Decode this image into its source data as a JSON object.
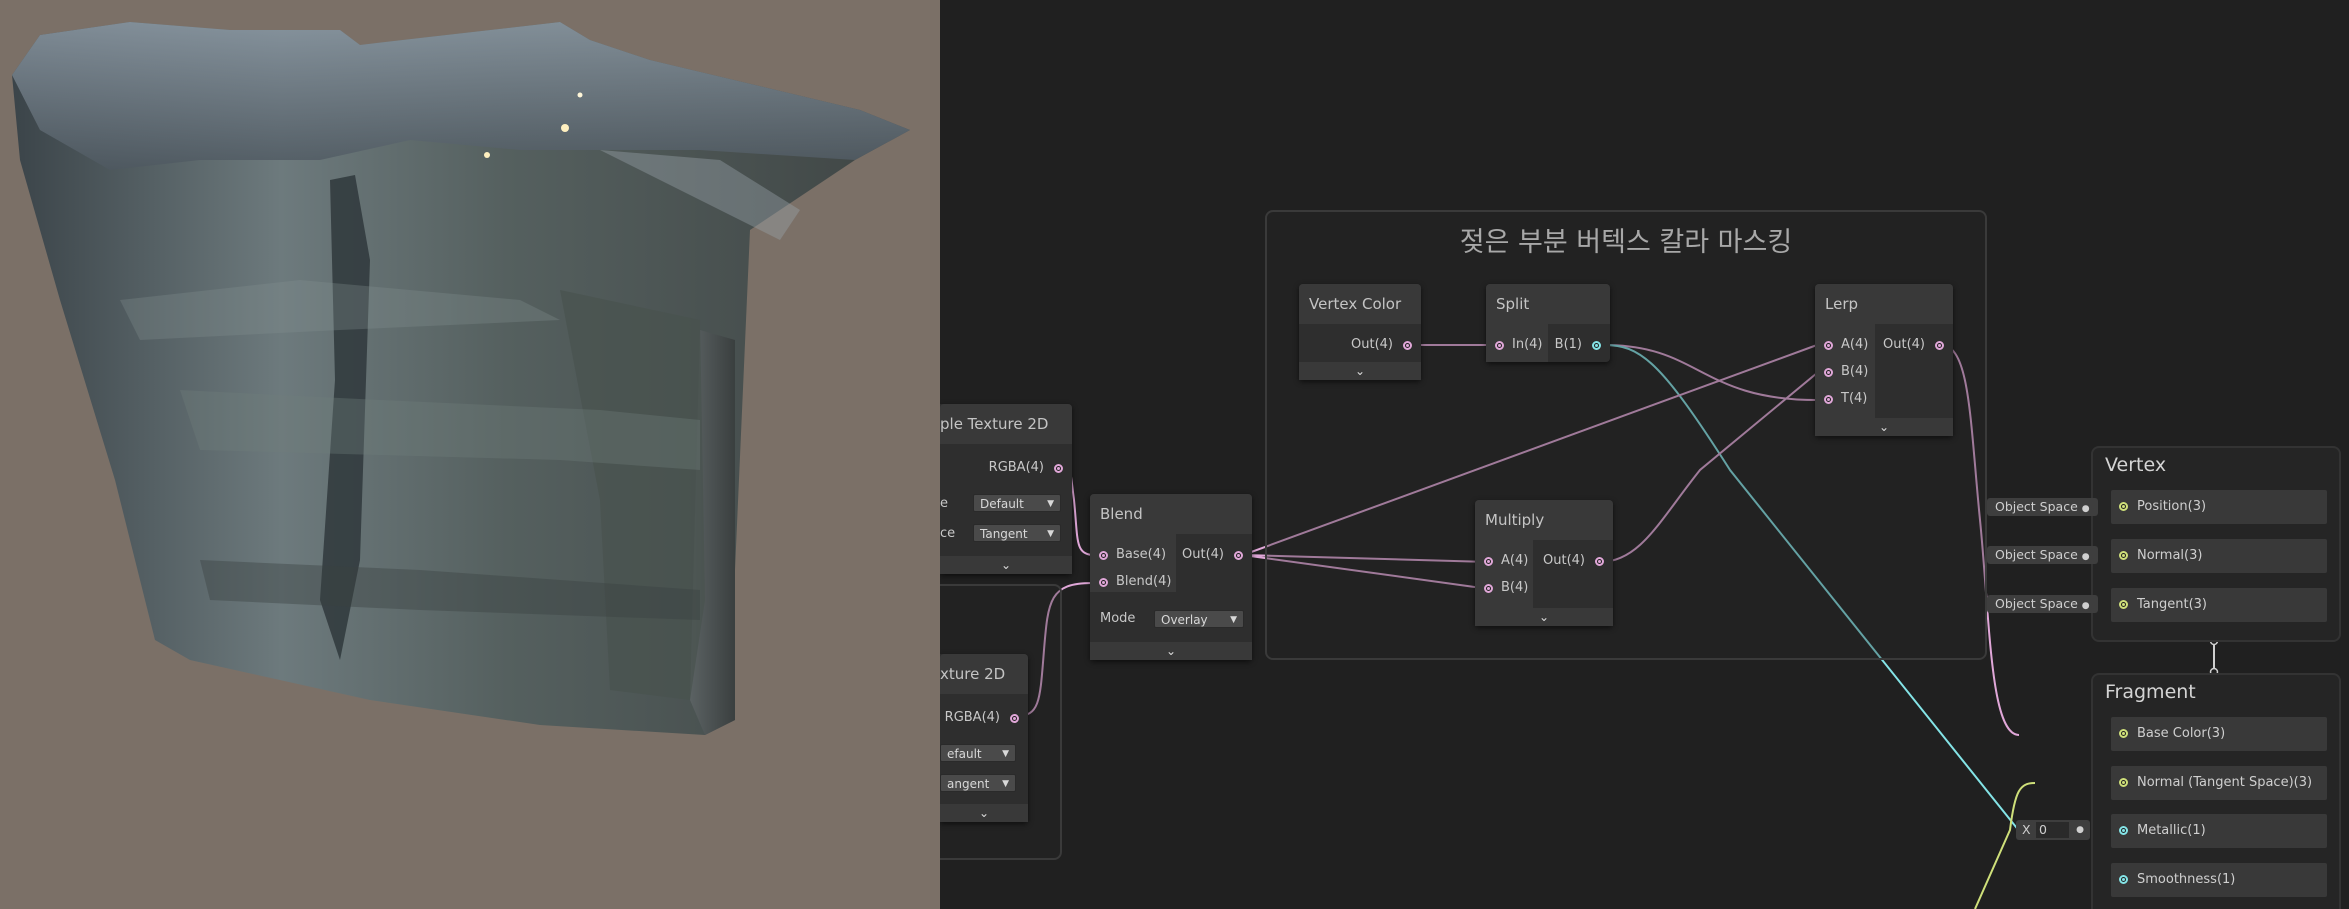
{
  "group": {
    "title": "젖은 부분 버텍스 칼라 마스킹"
  },
  "nodes": {
    "vertex_color": {
      "title": "Vertex Color",
      "out": "Out(4)"
    },
    "split": {
      "title": "Split",
      "in": "In(4)",
      "out": "B(1)"
    },
    "lerp": {
      "title": "Lerp",
      "a": "A(4)",
      "b": "B(4)",
      "t": "T(4)",
      "out": "Out(4)"
    },
    "multiply": {
      "title": "Multiply",
      "a": "A(4)",
      "b": "B(4)",
      "out": "Out(4)"
    },
    "blend": {
      "title": "Blend",
      "base": "Base(4)",
      "blend": "Blend(4)",
      "out": "Out(4)",
      "mode_label": "Mode",
      "mode_value": "Overlay"
    },
    "sample1": {
      "title": "ple Texture 2D",
      "out": "RGBA(4)",
      "row1_label": "e",
      "row1_value": "Default",
      "row2_label": "ce",
      "row2_value": "Tangent"
    },
    "sample2": {
      "title": "xture 2D",
      "out": "RGBA(4)",
      "row1_value": "efault",
      "row2_value": "angent"
    }
  },
  "vertex": {
    "title": "Vertex",
    "slots": [
      {
        "label": "Position(3)",
        "space": "Object Space"
      },
      {
        "label": "Normal(3)",
        "space": "Object Space"
      },
      {
        "label": "Tangent(3)",
        "space": "Object Space"
      }
    ]
  },
  "fragment": {
    "title": "Fragment",
    "slots": [
      {
        "label": "Base Color(3)"
      },
      {
        "label": "Normal (Tangent Space)(3)"
      },
      {
        "label": "Metallic(1)"
      },
      {
        "label": "Smoothness(1)"
      }
    ],
    "metallic_input": {
      "axis": "X",
      "value": "0"
    }
  },
  "icons": {
    "collapse": "chevron-down-icon"
  },
  "colors": {
    "vector4_port": "#e0a7d8",
    "float_port": "#84e4e7",
    "vector3_port": "#cfe07a",
    "graph_bg": "#202020",
    "preview_bg": "#7b7067"
  }
}
